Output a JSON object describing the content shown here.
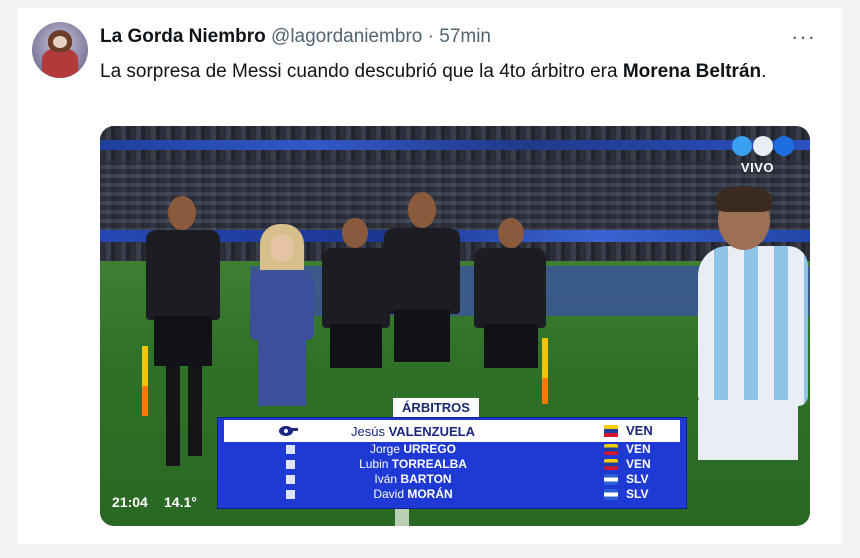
{
  "tweet": {
    "author_name": "La Gorda Niembro",
    "handle": "@lagordaniembro",
    "separator": "·",
    "time": "57min",
    "more_label": "···",
    "text_before": "La sorpresa de Messi cuando descubrió que la 4to árbitro era ",
    "text_bold": "Morena Beltrán",
    "text_after": "."
  },
  "media": {
    "broadcast_label": "VIVO",
    "clock": "21:04",
    "temperature": "14.1°",
    "panel_title": "ÁRBITROS",
    "referees": [
      {
        "first": "Jesús",
        "last": "VALENZUELA",
        "country": "VEN"
      },
      {
        "first": "Jorge",
        "last": "URREGO",
        "country": "VEN"
      },
      {
        "first": "Lubin",
        "last": "TORREALBA",
        "country": "VEN"
      },
      {
        "first": "Iván",
        "last": "BARTON",
        "country": "SLV"
      },
      {
        "first": "David",
        "last": "MORÁN",
        "country": "SLV"
      }
    ]
  },
  "colors": {
    "panel_blue": "#1f3ad4",
    "text_primary": "#0f1419",
    "text_secondary": "#536471"
  },
  "icons": [
    "avatar",
    "more-icon",
    "broadcaster-logo-icon",
    "whistle-icon",
    "flag-icon"
  ]
}
